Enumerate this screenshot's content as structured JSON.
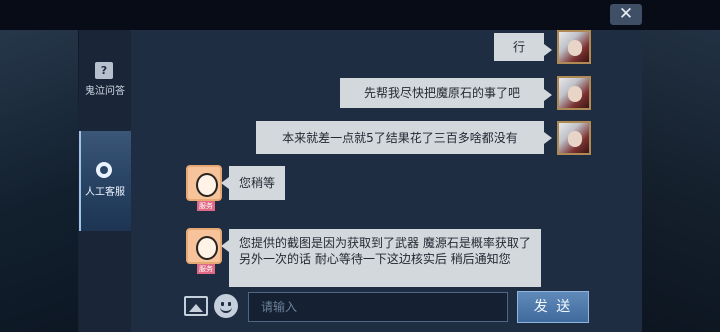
{
  "window": {
    "close_glyph": "✕"
  },
  "sidebar": {
    "items": [
      {
        "label": "鬼泣问答",
        "icon": "question-icon",
        "icon_glyph": "?"
      },
      {
        "label": "人工客服",
        "icon": "headset-icon"
      }
    ]
  },
  "messages": [
    {
      "from": "player",
      "text": "行"
    },
    {
      "from": "player",
      "text": "先帮我尽快把魔原石的事了吧"
    },
    {
      "from": "player",
      "text": "本来就差一点就5了结果花了三百多啥都没有"
    },
    {
      "from": "agent",
      "text": "您稍等",
      "tag": "服务"
    },
    {
      "from": "agent",
      "text": "您提供的截图是因为获取到了武器 魔源石是概率获取了  另外一次的话 耐心等待一下这边核实后 稍后通知您",
      "tag": "服务"
    }
  ],
  "composer": {
    "placeholder": "请输入",
    "send_label": "发 送"
  },
  "colors": {
    "panel": "#1f2d42",
    "bubble": "#d3d8dc",
    "send_button": "#4f79a9"
  }
}
